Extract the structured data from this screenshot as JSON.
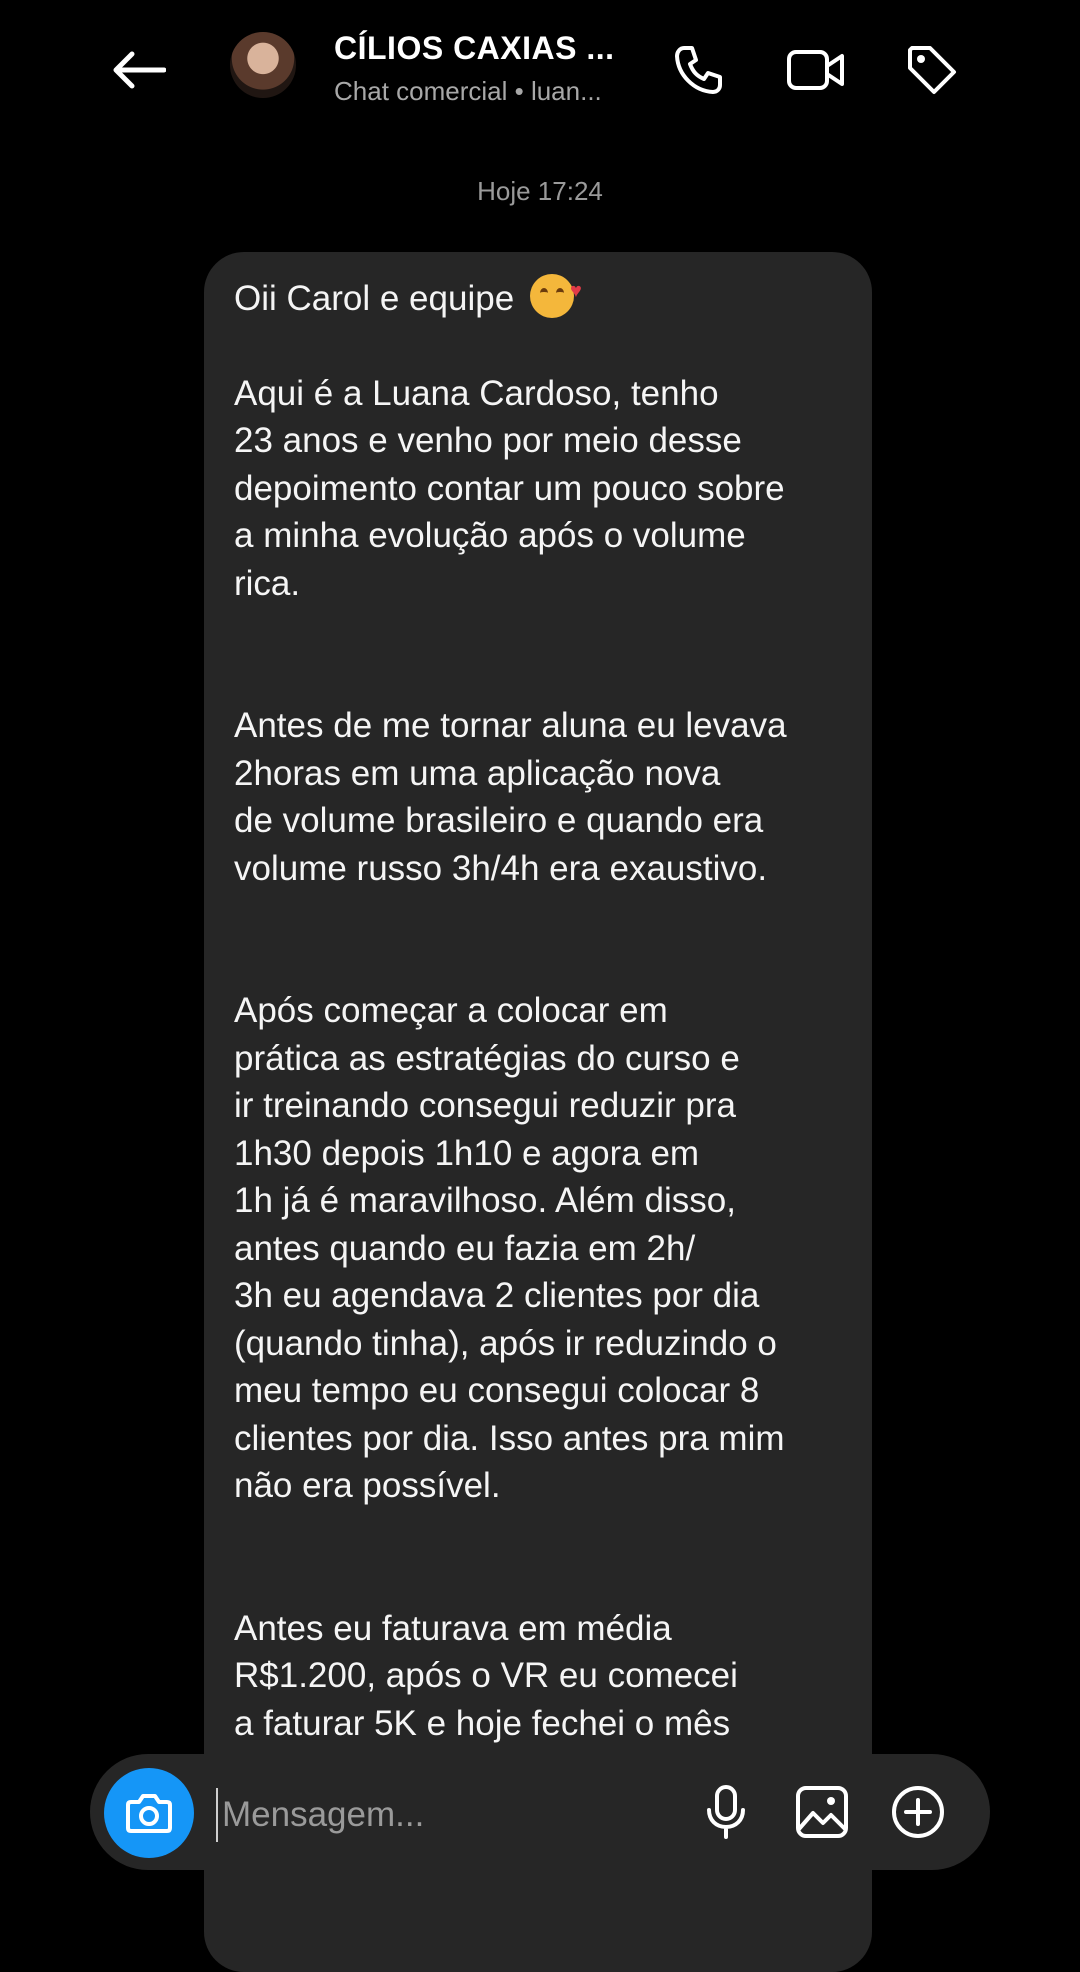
{
  "header": {
    "title": "CÍLIOS CAXIAS ...",
    "subtitle": "Chat comercial • luan..."
  },
  "icons": {
    "back": "arrow-left-icon",
    "phone": "phone-icon",
    "video": "video-camera-icon",
    "tag": "tag-icon",
    "camera": "camera-icon",
    "mic": "microphone-icon",
    "gallery": "image-icon",
    "plus": "plus-circle-icon"
  },
  "chat": {
    "timestamp": "Hoje 17:24",
    "message": {
      "greeting": "Oii Carol e equipe",
      "p1": [
        "Aqui é a Luana Cardoso, tenho",
        "23 anos e venho por meio desse",
        "depoimento contar um pouco sobre",
        "a minha evolução após o volume",
        "rica."
      ],
      "p2": [
        "Antes de me tornar aluna eu levava",
        "2horas em uma aplicação nova",
        "de volume brasileiro e quando era",
        "volume russo 3h/4h era exaustivo."
      ],
      "p3": [
        "Após começar a colocar em",
        "prática as estratégias do curso e",
        "ir treinando consegui reduzir pra",
        "1h30 depois 1h10 e agora em",
        "1h já é maravilhoso. Além disso,",
        "antes quando eu fazia em 2h/",
        "3h eu agendava 2 clientes por dia",
        "(quando tinha), após ir reduzindo o",
        "meu tempo eu consegui colocar 8",
        "clientes por dia. Isso antes pra mim",
        "não era possível."
      ],
      "p4": [
        "Antes eu faturava em média",
        "R$1.200, após o VR eu comecei",
        "a faturar 5K e hoje fechei o mês"
      ]
    }
  },
  "composer": {
    "placeholder": "Mensagem..."
  },
  "colors": {
    "background": "#000000",
    "bubble": "#262626",
    "accent": "#1596f7"
  }
}
